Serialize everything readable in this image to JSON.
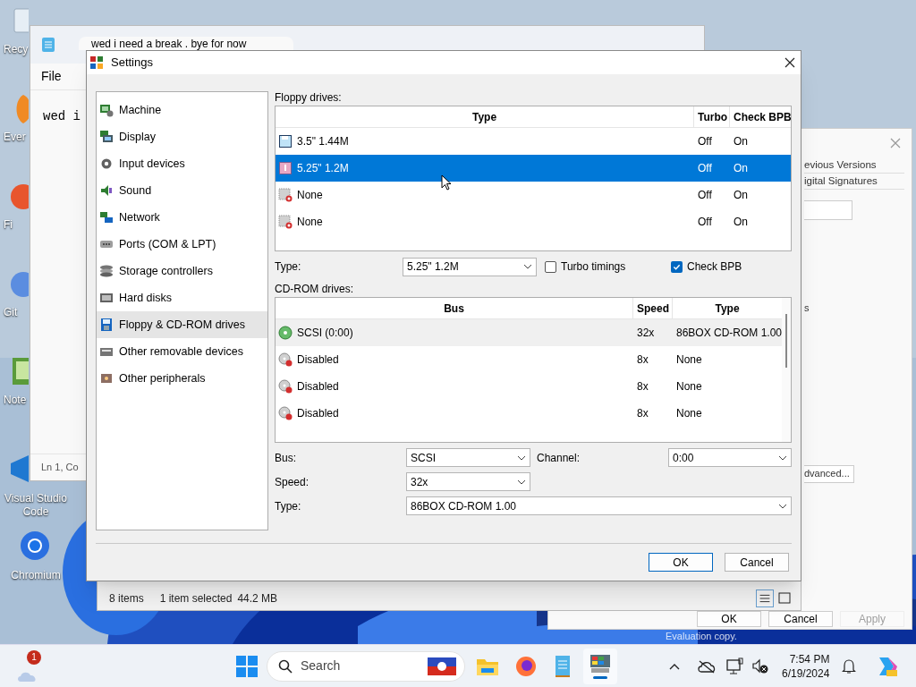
{
  "desktop": {
    "icons": [
      {
        "label": "Recy"
      },
      {
        "label": "Ever"
      },
      {
        "label": "Fi"
      },
      {
        "label": "Git"
      },
      {
        "label": "Note"
      },
      {
        "label": "Visual Studio Code"
      },
      {
        "label": "Chromium"
      }
    ]
  },
  "notepad": {
    "tab_title": "wed i need a break . bye for now",
    "menu": [
      "File"
    ],
    "text": "wed i",
    "status": "Ln 1, Co"
  },
  "explorer": {
    "item_count": "8 items",
    "selection": "1 item selected",
    "size": "44.2 MB"
  },
  "properties": {
    "tabs": [
      "evious Versions",
      "igital Signatures"
    ],
    "label": "s",
    "advanced_button": "dvanced...",
    "buttons": [
      {
        "label": "OK",
        "disabled": false
      },
      {
        "label": "Cancel",
        "disabled": false
      },
      {
        "label": "Apply",
        "disabled": true
      }
    ]
  },
  "evaluation_notice": "Evaluation copy.",
  "settings": {
    "title": "Settings",
    "sidebar": [
      {
        "label": "Machine",
        "selected": false
      },
      {
        "label": "Display",
        "selected": false
      },
      {
        "label": "Input devices",
        "selected": false
      },
      {
        "label": "Sound",
        "selected": false
      },
      {
        "label": "Network",
        "selected": false
      },
      {
        "label": "Ports (COM & LPT)",
        "selected": false
      },
      {
        "label": "Storage controllers",
        "selected": false
      },
      {
        "label": "Hard disks",
        "selected": false
      },
      {
        "label": "Floppy & CD-ROM drives",
        "selected": true
      },
      {
        "label": "Other removable devices",
        "selected": false
      },
      {
        "label": "Other peripherals",
        "selected": false
      }
    ],
    "floppy_label": "Floppy drives:",
    "floppy_table": {
      "columns": [
        "Type",
        "Turbo",
        "Check BPB"
      ],
      "rows": [
        {
          "kind": "floppy",
          "type": "3.5\" 1.44M",
          "turbo": "Off",
          "check_bpb": "On",
          "selected": false
        },
        {
          "kind": "floppy_525",
          "type": "5.25\" 1.2M",
          "turbo": "Off",
          "check_bpb": "On",
          "selected": true
        },
        {
          "kind": "empty",
          "type": "None",
          "turbo": "Off",
          "check_bpb": "On",
          "selected": false
        },
        {
          "kind": "empty",
          "type": "None",
          "turbo": "Off",
          "check_bpb": "On",
          "selected": false
        }
      ]
    },
    "floppy_type": {
      "label": "Type:",
      "value": "5.25\" 1.2M"
    },
    "turbo_timings": {
      "label": "Turbo timings",
      "checked": false
    },
    "check_bpb": {
      "label": "Check BPB",
      "checked": true
    },
    "cdrom_label": "CD-ROM drives:",
    "cdrom_table": {
      "columns": [
        "Bus",
        "Speed",
        "Type"
      ],
      "rows": [
        {
          "kind": "cdrom",
          "bus": "SCSI (0:00)",
          "speed": "32x",
          "type": "86BOX CD-ROM 1.00",
          "selected": true
        },
        {
          "kind": "disabled",
          "bus": "Disabled",
          "speed": "8x",
          "type": "None",
          "selected": false
        },
        {
          "kind": "disabled",
          "bus": "Disabled",
          "speed": "8x",
          "type": "None",
          "selected": false
        },
        {
          "kind": "disabled",
          "bus": "Disabled",
          "speed": "8x",
          "type": "None",
          "selected": false
        }
      ]
    },
    "bus": {
      "label": "Bus:",
      "value": "SCSI"
    },
    "channel": {
      "label": "Channel:",
      "value": "0:00"
    },
    "speed": {
      "label": "Speed:",
      "value": "32x"
    },
    "cd_type": {
      "label": "Type:",
      "value": "86BOX CD-ROM 1.00"
    },
    "buttons": [
      "OK",
      "Cancel"
    ]
  },
  "taskbar": {
    "weather_badge": "1",
    "search_placeholder": "Search",
    "time": "7:54 PM",
    "date": "6/19/2024"
  }
}
